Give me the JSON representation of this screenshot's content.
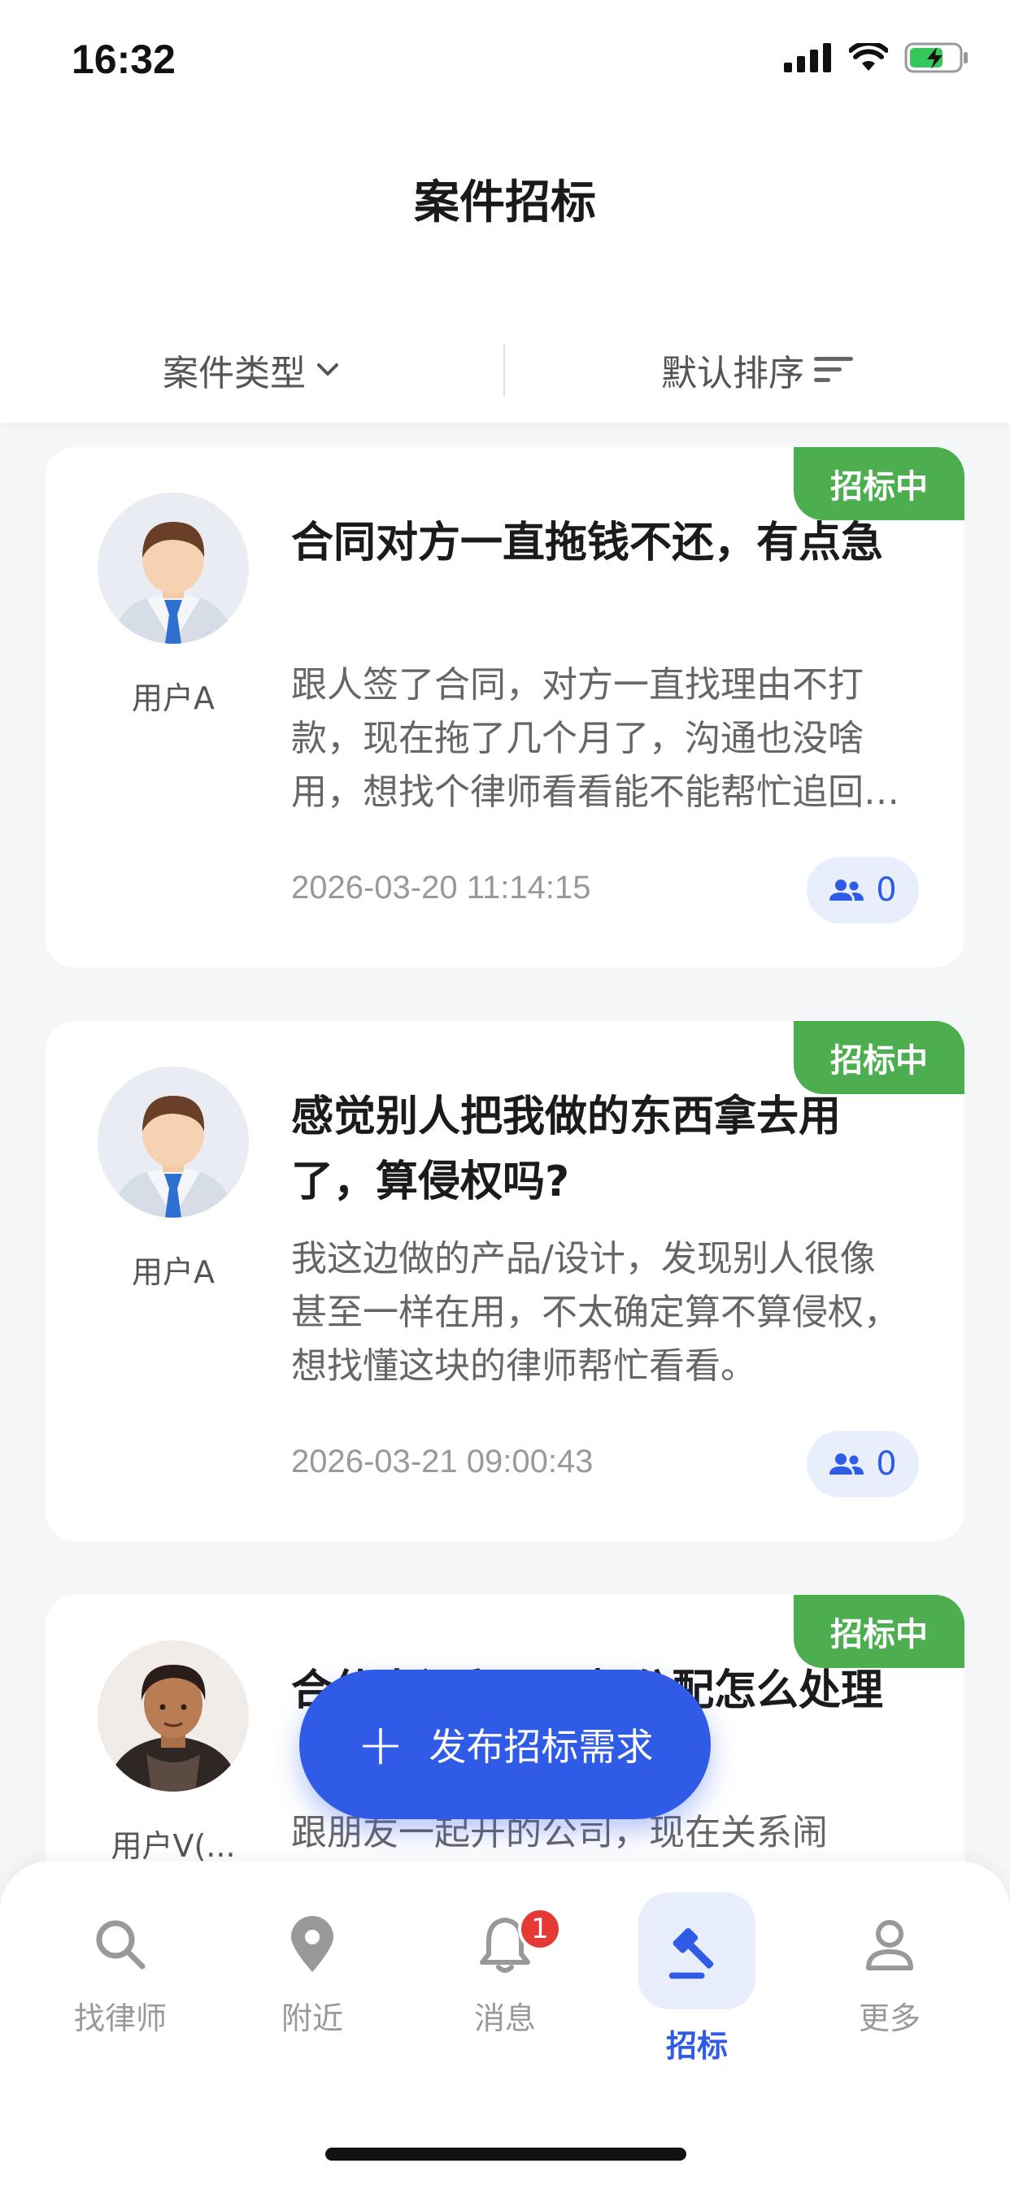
{
  "status_bar": {
    "time": "16:32"
  },
  "header": {
    "title": "案件招标",
    "filters": {
      "type_label": "案件类型",
      "sort_label": "默认排序"
    }
  },
  "cases": [
    {
      "status": "招标中",
      "user": "用户A",
      "title": "合同对方一直拖钱不还，有点急",
      "description": "跟人签了合同，对方一直找理由不打款，现在拖了几个月了，沟通也没啥用，想找个律师看看能不能帮忙追回来。",
      "time": "2026-03-20 11:14:15",
      "bids": "0"
    },
    {
      "status": "招标中",
      "user": "用户A",
      "title": "感觉别人把我做的东西拿去用了，算侵权吗?",
      "description": "我这边做的产品/设计，发现别人很像甚至一样在用，不太确定算不算侵权，想找懂这块的律师帮忙看看。",
      "time": "2026-03-21 09:00:43",
      "bids": "0"
    },
    {
      "status": "招标中",
      "user": "用户V(...",
      "title": "合伙人闹翻了股权分配怎么处理",
      "description": "跟朋友一起开的公司，现在关系闹",
      "time": "",
      "bids": ""
    }
  ],
  "fab": {
    "label": "发布招标需求"
  },
  "tabs": [
    {
      "label": "找律师",
      "icon": "search-icon"
    },
    {
      "label": "附近",
      "icon": "location-icon"
    },
    {
      "label": "消息",
      "icon": "bell-icon",
      "badge": "1"
    },
    {
      "label": "招标",
      "icon": "gavel-icon",
      "active": true
    },
    {
      "label": "更多",
      "icon": "person-icon"
    }
  ],
  "colors": {
    "accent": "#2f5be7",
    "status_green": "#4cae4f",
    "badge_red": "#e53935"
  }
}
